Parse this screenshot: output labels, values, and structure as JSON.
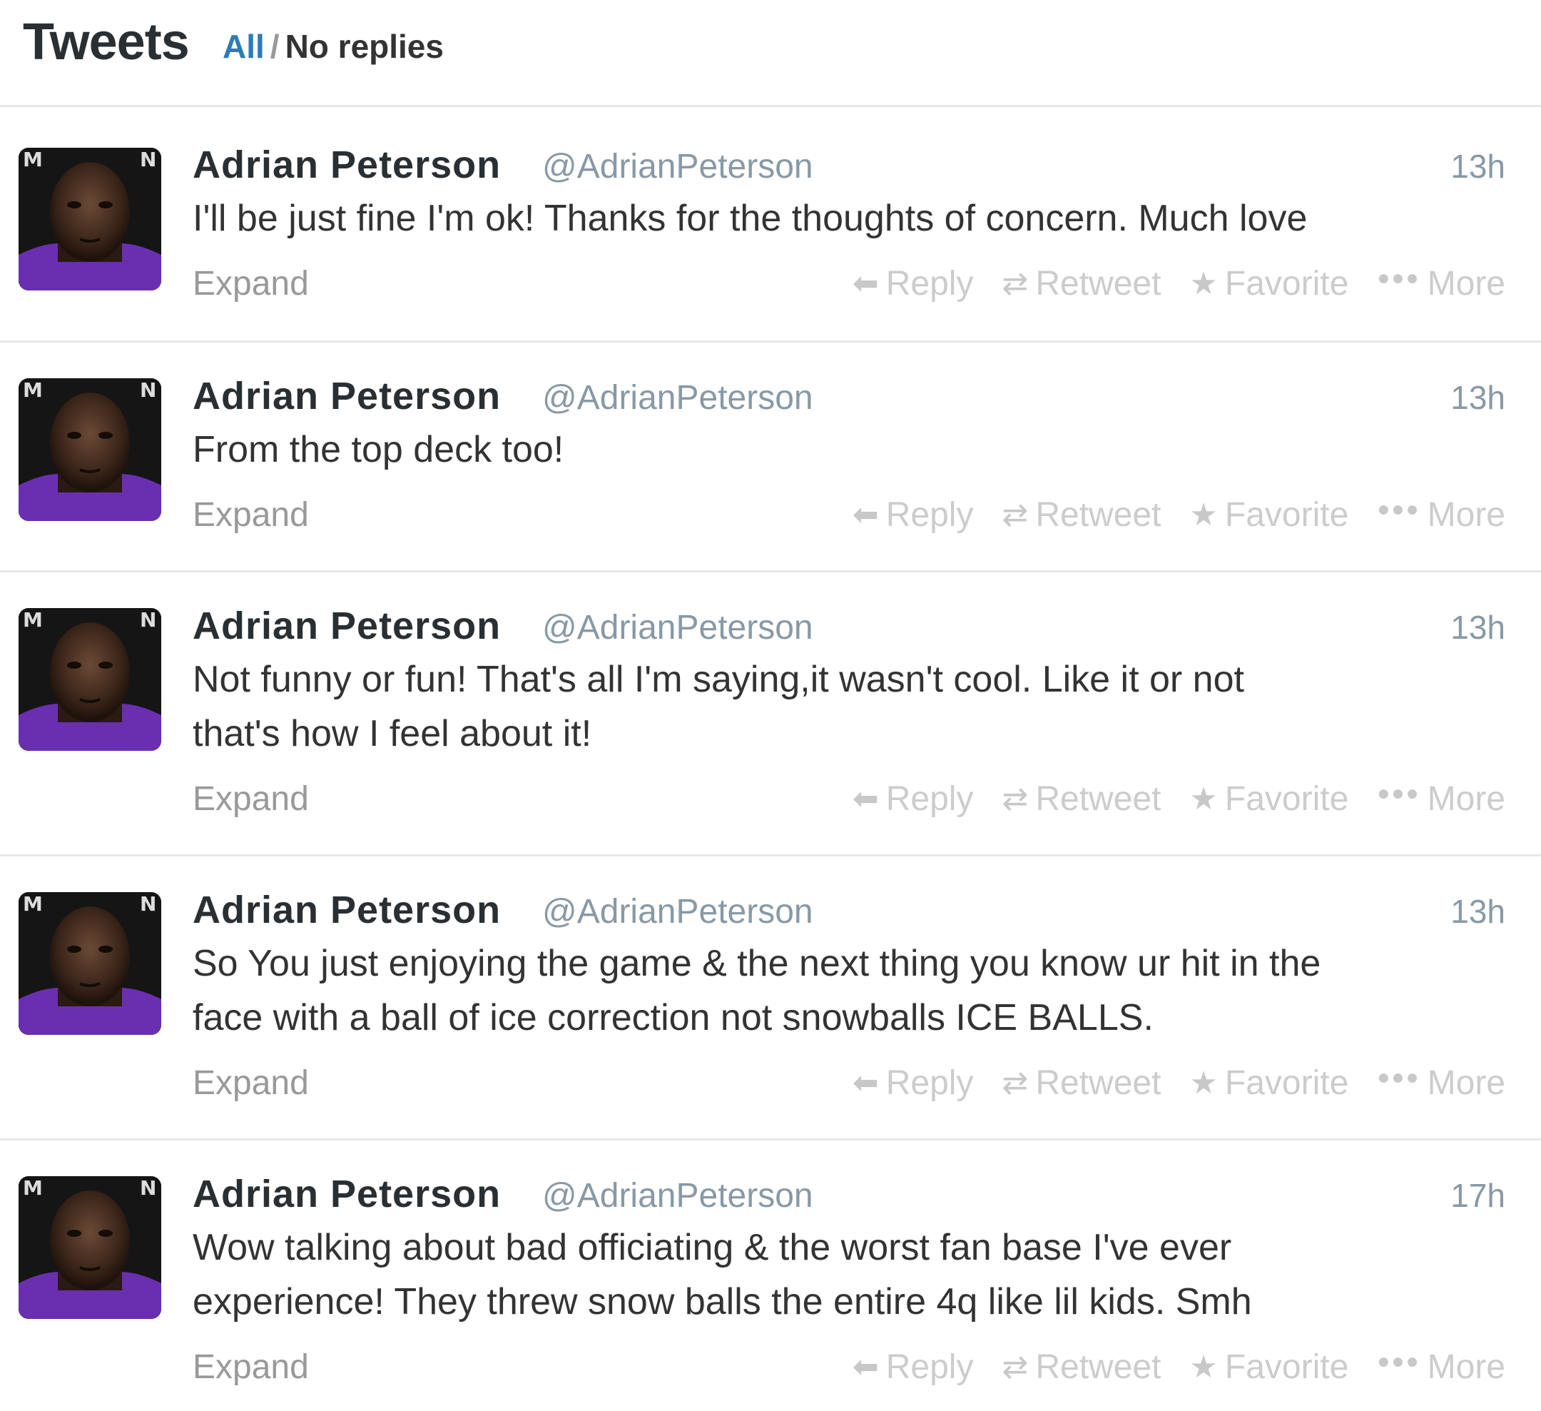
{
  "header": {
    "title": "Tweets",
    "filter_all": "All",
    "filter_separator": "/",
    "filter_no_replies": "No replies"
  },
  "actions": {
    "reply": "Reply",
    "retweet": "Retweet",
    "favorite": "Favorite",
    "more": "More",
    "expand": "Expand"
  },
  "icons": {
    "reply": "reply-arrow-icon",
    "retweet": "retweet-icon",
    "favorite": "star-icon",
    "more": "ellipsis-icon"
  },
  "colors": {
    "link_blue": "#2b7bb9",
    "avatar_purple": "#6a2fb0",
    "muted_gray": "#8899a6"
  },
  "tweets": [
    {
      "name": "Adrian Peterson",
      "handle": "@AdrianPeterson",
      "time": "13h",
      "text": "I'll be just fine I'm ok! Thanks for the thoughts of concern. Much love"
    },
    {
      "name": "Adrian Peterson",
      "handle": "@AdrianPeterson",
      "time": "13h",
      "text": "From the top deck too!"
    },
    {
      "name": "Adrian Peterson",
      "handle": "@AdrianPeterson",
      "time": "13h",
      "text": "Not funny or fun! That's all I'm saying,it wasn't cool. Like it or not\nthat's how I feel about it!"
    },
    {
      "name": "Adrian Peterson",
      "handle": "@AdrianPeterson",
      "time": "13h",
      "text": "So You just enjoying the game & the next thing you know ur hit in the\nface with a ball of ice correction not snowballs ICE BALLS."
    },
    {
      "name": "Adrian Peterson",
      "handle": "@AdrianPeterson",
      "time": "17h",
      "text": "Wow talking about bad officiating & the worst fan base I've ever\nexperience! They threw snow balls the entire 4q like lil kids. Smh"
    }
  ]
}
